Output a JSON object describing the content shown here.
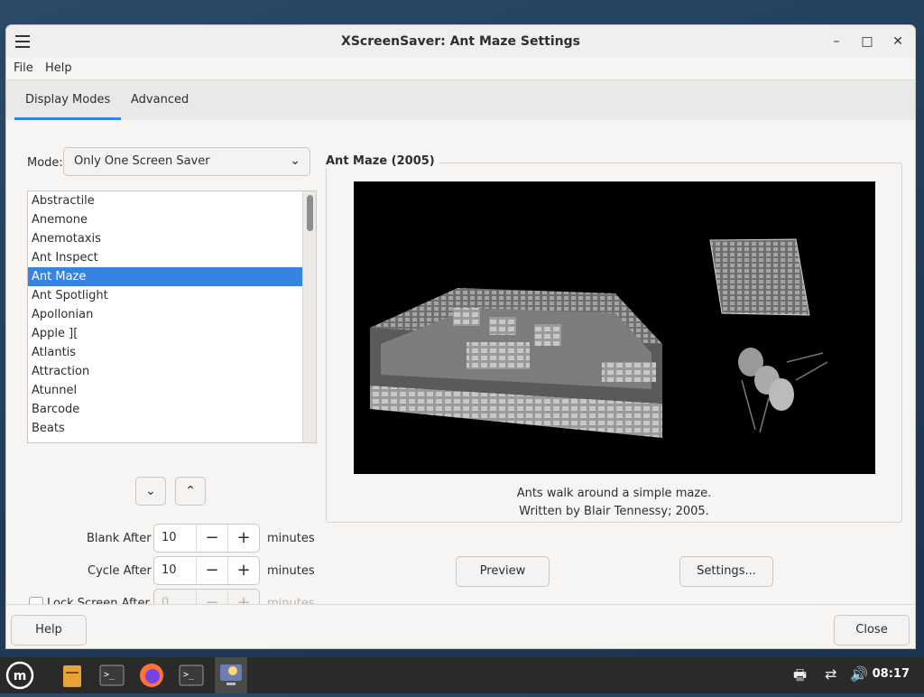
{
  "window": {
    "title": "XScreenSaver: Ant Maze Settings",
    "minimize": "–",
    "maximize": "□",
    "close": "✕"
  },
  "menu": {
    "file": "File",
    "help": "Help"
  },
  "tabs": [
    {
      "label": "Display Modes",
      "active": true
    },
    {
      "label": "Advanced",
      "active": false
    }
  ],
  "mode": {
    "label": "Mode:",
    "value": "Only One Screen Saver"
  },
  "savers": [
    "Abstractile",
    "Anemone",
    "Anemotaxis",
    "Ant Inspect",
    "Ant Maze",
    "Ant Spotlight",
    "Apollonian",
    "Apple ][",
    "Atlantis",
    "Attraction",
    "Atunnel",
    "Barcode",
    "Beats"
  ],
  "selected_saver": "Ant Maze",
  "blank_after": {
    "label": "Blank After",
    "value": "10",
    "unit": "minutes"
  },
  "cycle_after": {
    "label": "Cycle After",
    "value": "10",
    "unit": "minutes"
  },
  "lock_after": {
    "label": "Lock Screen After",
    "value": "0",
    "unit": "minutes",
    "checked": false,
    "enabled": false
  },
  "spin": {
    "minus": "−",
    "plus": "+"
  },
  "preview_panel": {
    "title": "Ant Maze (2005)",
    "description": "Ants walk around a simple maze.",
    "credit": "Written by Blair Tennessy; 2005."
  },
  "buttons": {
    "preview": "Preview",
    "settings": "Settings...",
    "help": "Help",
    "close": "Close"
  },
  "taskbar": {
    "clock": "08:17"
  },
  "icons": {
    "menu": "hamburger-icon",
    "down": "chevron-down-icon",
    "up": "chevron-up-icon"
  },
  "colors": {
    "accent": "#3584e4",
    "taskbar": "#2a2a2a"
  }
}
